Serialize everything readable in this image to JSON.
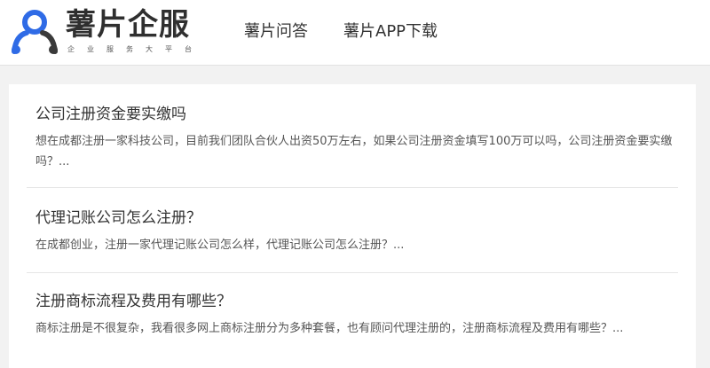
{
  "brand": {
    "name": "薯片企服",
    "tagline": [
      "企",
      "业",
      "服",
      "务",
      "大",
      "平",
      "台"
    ],
    "colors": {
      "blue": "#2f6be6",
      "dark": "#3a3a3a"
    }
  },
  "nav": {
    "items": [
      {
        "label": "薯片问答"
      },
      {
        "label": "薯片APP下载"
      }
    ]
  },
  "articles": [
    {
      "title": "公司注册资金要实缴吗",
      "summary": "想在成都注册一家科技公司，目前我们团队合伙人出资50万左右，如果公司注册资金填写100万可以吗，公司注册资金要实缴吗？..."
    },
    {
      "title": "代理记账公司怎么注册？",
      "summary": "在成都创业，注册一家代理记账公司怎么样，代理记账公司怎么注册？..."
    },
    {
      "title": "注册商标流程及费用有哪些？",
      "summary": "商标注册是不很复杂，我看很多网上商标注册分为多种套餐，也有顾问代理注册的，注册商标流程及费用有哪些？..."
    }
  ]
}
